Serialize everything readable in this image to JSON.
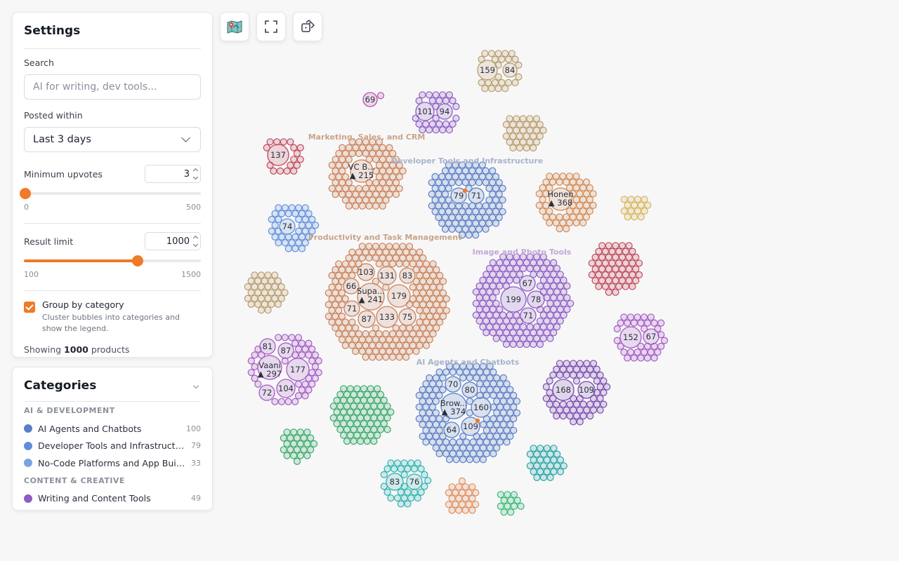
{
  "settings": {
    "title": "Settings",
    "search": {
      "label": "Search",
      "placeholder": "AI for writing, dev tools..."
    },
    "posted_within": {
      "label": "Posted within",
      "value": "Last 3 days"
    },
    "min_upvotes": {
      "label": "Minimum upvotes",
      "value": "3",
      "min": "0",
      "max": "500",
      "fraction": 0.006
    },
    "result_limit": {
      "label": "Result limit",
      "value": "1000",
      "min": "100",
      "max": "1500",
      "fraction": 0.643
    },
    "group_by": {
      "label": "Group by category",
      "description": "Cluster bubbles into categories and show the legend.",
      "checked": true
    },
    "showing": {
      "prefix": "Showing",
      "count": "1000",
      "suffix": "products"
    }
  },
  "toolbar": {
    "map_icon": "map-icon",
    "fullscreen_icon": "fullscreen-icon",
    "random_icon": "dice-icon"
  },
  "accent_color": "#ef7a27",
  "categories": {
    "title": "Categories",
    "groups": [
      {
        "label": "AI & DEVELOPMENT",
        "items": [
          {
            "name": "AI Agents and Chatbots",
            "count": "100",
            "color": "#5b7fc4"
          },
          {
            "name": "Developer Tools and Infrastructure",
            "count": "79",
            "color": "#5f8fdc"
          },
          {
            "name": "No-Code Platforms and App Build...",
            "count": "33",
            "color": "#7aa4e0"
          }
        ]
      },
      {
        "label": "CONTENT & CREATIVE",
        "items": [
          {
            "name": "Writing and Content Tools",
            "count": "49",
            "color": "#8e5cc4"
          }
        ]
      }
    ]
  },
  "bubble_map": {
    "cluster_labels": [
      {
        "text": "Marketing, Sales, and CRM",
        "color": "#c9a48a"
      },
      {
        "text": "Developer Tools and Infrastructure",
        "color": "#a7b4cc"
      },
      {
        "text": "Productivity and Task Management",
        "color": "#c9a48a"
      },
      {
        "text": "Image and Photo Tools",
        "color": "#c2a8d6"
      },
      {
        "text": "AI Agents and Chatbots",
        "color": "#a7b4cc"
      }
    ],
    "bubble_labels": [
      "159",
      "84",
      "69",
      "101",
      "94",
      "137",
      "VC B...",
      "▲ 215",
      "79",
      "71",
      "Honen",
      "▲ 368",
      "74",
      "103",
      "131",
      "83",
      "66",
      "Supa...",
      "▲ 241",
      "179",
      "71",
      "87",
      "133",
      "75",
      "67",
      "199",
      "78",
      "71",
      "152",
      "67",
      "81",
      "87",
      "Vaani",
      "▲ 297",
      "177",
      "72",
      "104",
      "70",
      "80",
      "Brow...",
      "▲ 374",
      "160",
      "64",
      "109",
      "168",
      "109",
      "83",
      "76"
    ]
  }
}
